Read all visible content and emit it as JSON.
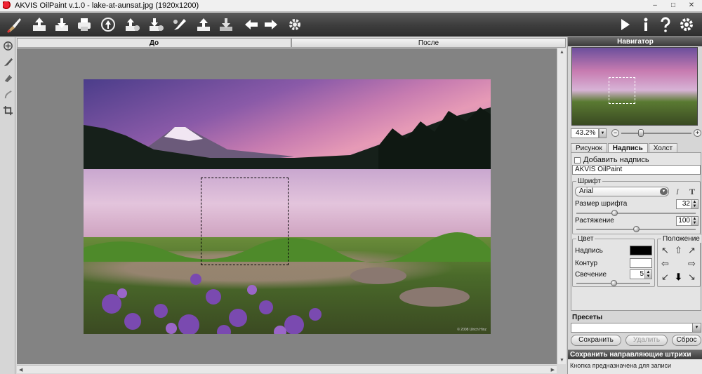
{
  "window": {
    "title": "AKVIS OilPaint v.1.0 - lake-at-aunsat.jpg (1920x1200)",
    "minimize": "–",
    "maximize": "□",
    "close": "✕"
  },
  "toolbar": {
    "icons": [
      "brush-logo-icon",
      "open-icon",
      "save-icon",
      "print-icon",
      "share-icon",
      "import-strokes-icon",
      "export-strokes-icon",
      "preview-icon",
      "brush-settings-icon",
      "upload-icon",
      "download-icon",
      "undo-icon",
      "redo-icon",
      "settings-gear-icon",
      "run-icon",
      "info-icon",
      "help-icon",
      "preferences-icon"
    ],
    "accent": "#3a3a3a"
  },
  "canvas_tabs": {
    "before": "До",
    "after": "После"
  },
  "image": {
    "watermark": "© 2008 Ulrich Hinz"
  },
  "navigator": {
    "title": "Навигатор",
    "zoom": "43.2%",
    "minus": "−",
    "plus": "+"
  },
  "panel_tabs": {
    "drawing": "Рисунок",
    "inscription": "Надпись",
    "canvas": "Холст"
  },
  "inscription": {
    "add_label": "Добавить надпись",
    "text_value": "AKVIS OilPaint",
    "font_group": "Шрифт",
    "font_name": "Arial",
    "italic": "I",
    "bold": "T",
    "size_label": "Размер шрифта",
    "size_value": "32",
    "size_fraction": 0.32,
    "stretch_label": "Растяжение",
    "stretch_value": "100",
    "stretch_fraction": 0.5,
    "color_group": "Цвет",
    "text_color_label": "Надпись",
    "text_color": "#000000",
    "outline_label": "Контур",
    "outline_color": "#ffffff",
    "glow_label": "Свечение",
    "glow_value": "5",
    "glow_fraction": 0.5,
    "position_group": "Положение"
  },
  "presets": {
    "title": "Пресеты",
    "save": "Сохранить",
    "delete": "Удалить",
    "reset": "Сброс"
  },
  "help": {
    "title": "Сохранить направляющие штрихи",
    "text": "Кнопка предназначена для записи"
  }
}
